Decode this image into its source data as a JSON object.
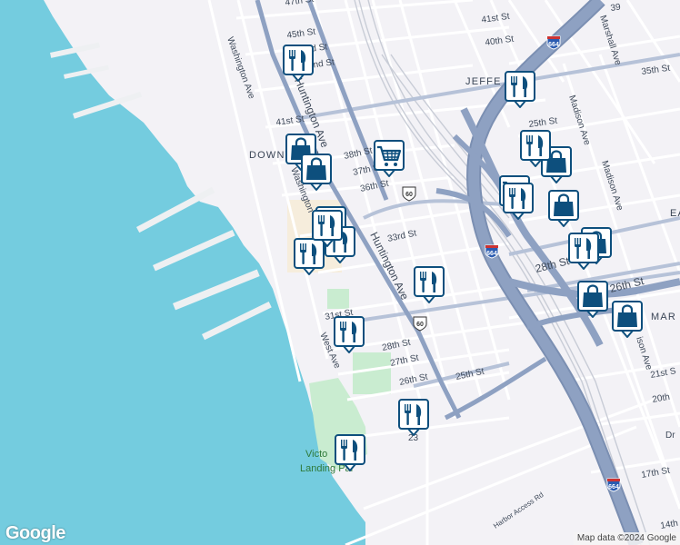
{
  "map": {
    "area_labels": [
      {
        "id": "downtown",
        "text": "DOWNTOWN"
      },
      {
        "id": "jefferson",
        "text": "JEFFE"
      },
      {
        "id": "east",
        "text": "EA"
      },
      {
        "id": "mar",
        "text": "MAR"
      }
    ],
    "street_labels": [
      {
        "id": "s47",
        "text": "47th St"
      },
      {
        "id": "s45",
        "text": "45th St"
      },
      {
        "id": "s43",
        "text": "3rd St"
      },
      {
        "id": "s42",
        "text": "42nd St"
      },
      {
        "id": "s41w",
        "text": "41st St"
      },
      {
        "id": "s41e",
        "text": "41st St"
      },
      {
        "id": "s40",
        "text": "40th St"
      },
      {
        "id": "s39",
        "text": "39"
      },
      {
        "id": "s35",
        "text": "35th St"
      },
      {
        "id": "s25n",
        "text": "25th St"
      },
      {
        "id": "s38",
        "text": "38th St"
      },
      {
        "id": "s37",
        "text": "37th St"
      },
      {
        "id": "s36",
        "text": "36th St"
      },
      {
        "id": "s33",
        "text": "33rd St"
      },
      {
        "id": "s31",
        "text": "31st St"
      },
      {
        "id": "s28w",
        "text": "28th St"
      },
      {
        "id": "s27",
        "text": "27th St"
      },
      {
        "id": "s26w",
        "text": "26th St"
      },
      {
        "id": "s25w",
        "text": "25th St"
      },
      {
        "id": "s28e",
        "text": "28th St"
      },
      {
        "id": "s26e",
        "text": "26th St"
      },
      {
        "id": "s21",
        "text": "21st S"
      },
      {
        "id": "s20",
        "text": "20th"
      },
      {
        "id": "s17",
        "text": "17th St"
      },
      {
        "id": "s14",
        "text": "14th"
      },
      {
        "id": "dr",
        "text": "Dr"
      },
      {
        "id": "s23",
        "text": "23"
      },
      {
        "id": "hunt1",
        "text": "Huntington Ave"
      },
      {
        "id": "hunt2",
        "text": "Huntington Ave"
      },
      {
        "id": "wash",
        "text": "Washington Ave"
      },
      {
        "id": "wash2",
        "text": "Washington"
      },
      {
        "id": "west",
        "text": "West Ave"
      },
      {
        "id": "marshall",
        "text": "Marshall Ave"
      },
      {
        "id": "madison1",
        "text": "Madison Ave"
      },
      {
        "id": "madison2",
        "text": "Madison Ave"
      },
      {
        "id": "madison3",
        "text": "ison Ave"
      },
      {
        "id": "harbor",
        "text": "Harbor Access Rd"
      },
      {
        "id": "victory1",
        "text": "Victo"
      },
      {
        "id": "victory2",
        "text": "Landing Par"
      }
    ],
    "shields": [
      {
        "id": "i664a",
        "text": "664",
        "kind": "interstate"
      },
      {
        "id": "i664b",
        "text": "664",
        "kind": "interstate"
      },
      {
        "id": "i664c",
        "text": "664",
        "kind": "interstate"
      },
      {
        "id": "us60a",
        "text": "60",
        "kind": "us-route"
      },
      {
        "id": "us60b",
        "text": "60",
        "kind": "us-route"
      }
    ],
    "markers": [
      {
        "id": "m1",
        "type": "restaurant"
      },
      {
        "id": "m2",
        "type": "restaurant"
      },
      {
        "id": "m3",
        "type": "shopping-bag"
      },
      {
        "id": "m4",
        "type": "shopping-bag"
      },
      {
        "id": "m5",
        "type": "grocery-cart"
      },
      {
        "id": "m6",
        "type": "restaurant"
      },
      {
        "id": "m7",
        "type": "restaurant"
      },
      {
        "id": "m8",
        "type": "restaurant"
      },
      {
        "id": "m9",
        "type": "restaurant"
      },
      {
        "id": "m10",
        "type": "restaurant"
      },
      {
        "id": "m11",
        "type": "restaurant"
      },
      {
        "id": "m12",
        "type": "restaurant"
      },
      {
        "id": "m13",
        "type": "shopping-bag"
      },
      {
        "id": "m14",
        "type": "grocery-cart"
      },
      {
        "id": "m15",
        "type": "restaurant"
      },
      {
        "id": "m16",
        "type": "shopping-bag"
      },
      {
        "id": "m17",
        "type": "shopping-bag"
      },
      {
        "id": "m18",
        "type": "restaurant"
      },
      {
        "id": "m19",
        "type": "shopping-bag"
      },
      {
        "id": "m20",
        "type": "shopping-bag"
      },
      {
        "id": "m21",
        "type": "restaurant"
      },
      {
        "id": "m22",
        "type": "restaurant"
      }
    ],
    "colors": {
      "water": "#74ccdf",
      "land": "#f3f2f6",
      "park": "#c9ecd0",
      "highway": "#8ea1c2",
      "highway_dark": "#7b8fb2",
      "street": "#ffffff",
      "marker": "#0d4f7d"
    }
  },
  "branding": {
    "logo_text": "Google"
  },
  "attribution": {
    "text": "Map data ©2024 Google"
  }
}
